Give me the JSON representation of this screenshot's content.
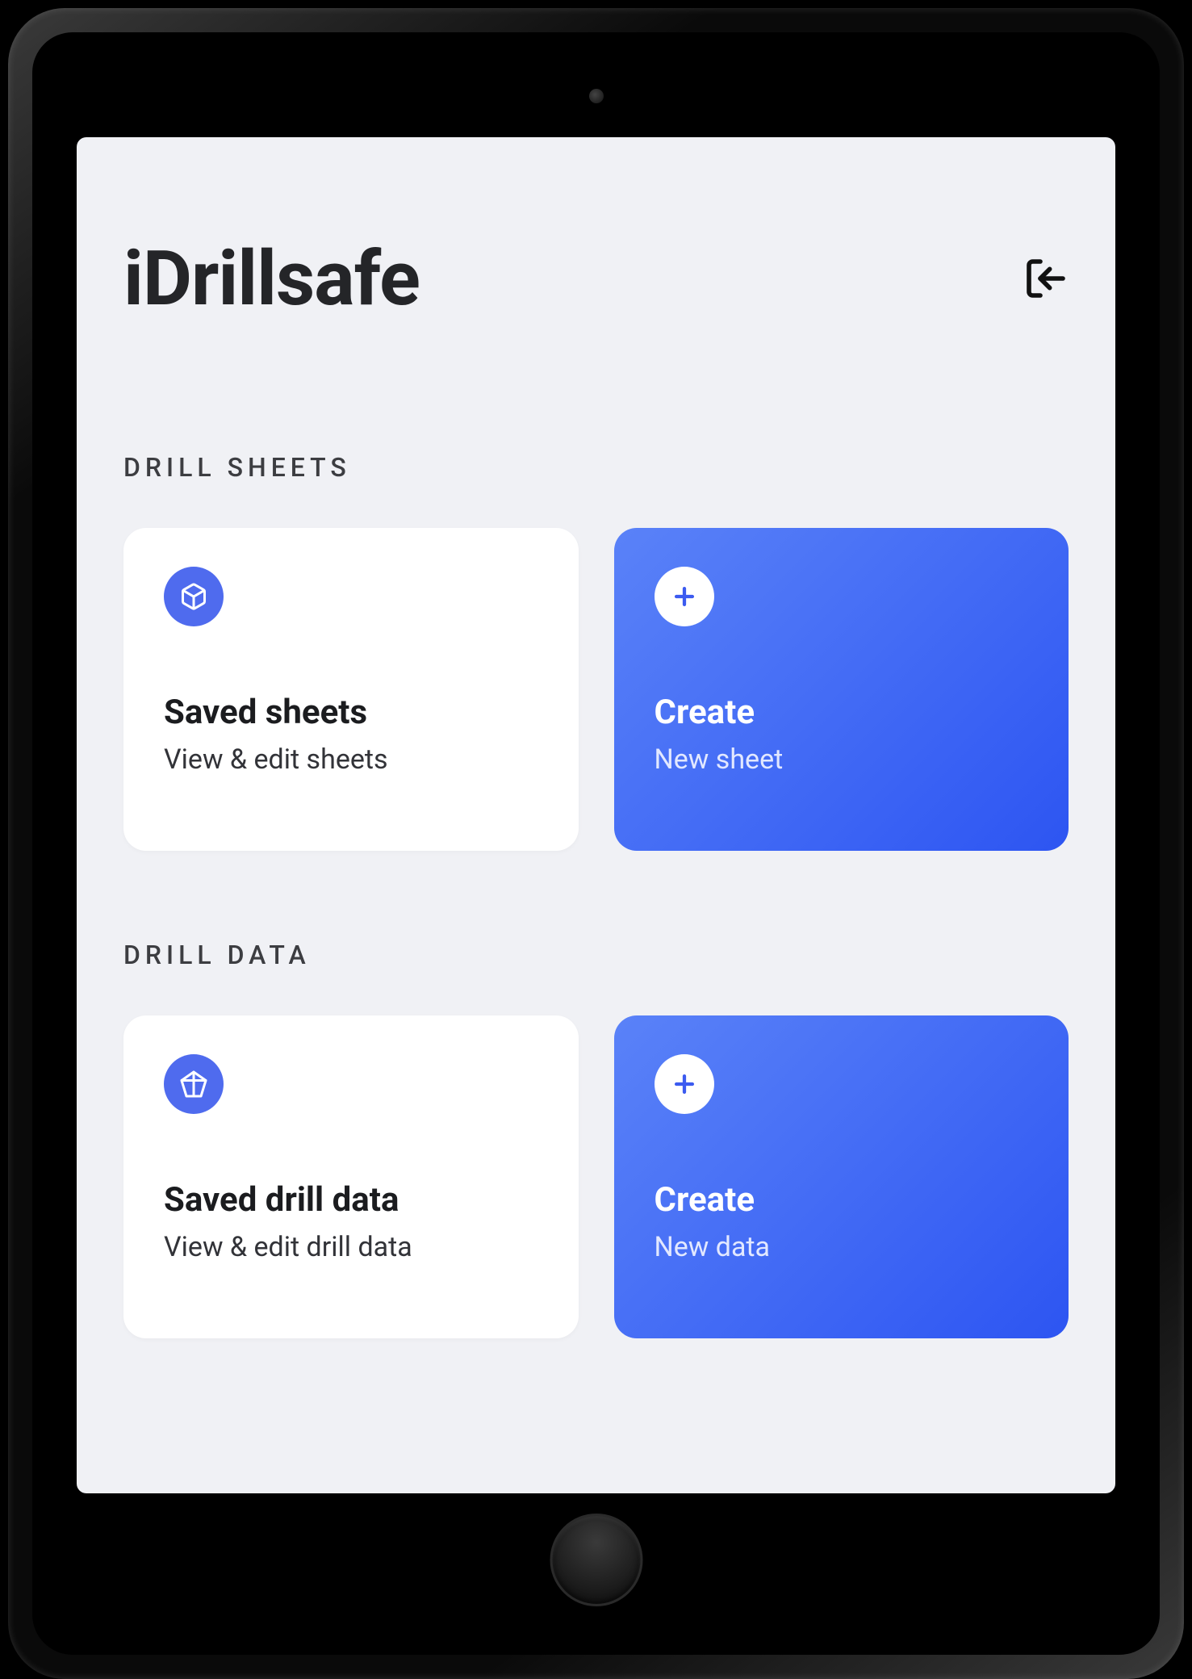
{
  "header": {
    "title": "iDrillsafe"
  },
  "sections": {
    "sheets": {
      "label": "DRILL SHEETS",
      "saved": {
        "title": "Saved sheets",
        "subtitle": "View & edit sheets"
      },
      "create": {
        "title": "Create",
        "subtitle": "New sheet"
      }
    },
    "data": {
      "label": "DRILL DATA",
      "saved": {
        "title": "Saved drill data",
        "subtitle": "View & edit drill data"
      },
      "create": {
        "title": "Create",
        "subtitle": "New data"
      }
    }
  }
}
